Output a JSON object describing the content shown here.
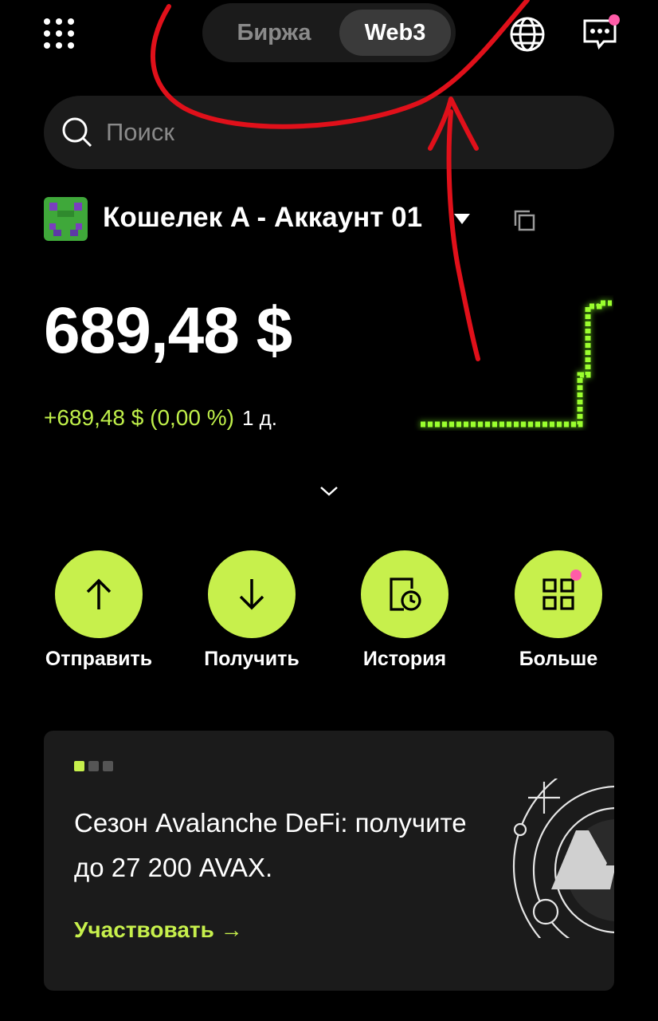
{
  "header": {
    "tabs": [
      {
        "label": "Биржа",
        "active": false
      },
      {
        "label": "Web3",
        "active": true
      }
    ],
    "icons": [
      "menu-grid-icon",
      "globe-icon",
      "chat-icon"
    ]
  },
  "search": {
    "placeholder": "Поиск"
  },
  "wallet": {
    "name": "Кошелек A - Аккаунт 01"
  },
  "balance": {
    "amount": "689,48 $",
    "change": "+689,48 $ (0,00 %)",
    "period": "1 д."
  },
  "actions": [
    {
      "label": "Отправить",
      "icon": "arrow-up-icon"
    },
    {
      "label": "Получить",
      "icon": "arrow-down-icon"
    },
    {
      "label": "История",
      "icon": "history-icon"
    },
    {
      "label": "Больше",
      "icon": "apps-grid-icon",
      "badge": true
    }
  ],
  "promo": {
    "title": "Сезон Avalanche DeFi: получите до 27 200 AVAX.",
    "cta": "Участвовать →",
    "slide_count": 3,
    "active_slide": 1
  },
  "colors": {
    "accent": "#c7f04c",
    "change_positive": "#c0f04a",
    "badge": "#ff5ca8",
    "annotation": "#e0101a"
  }
}
